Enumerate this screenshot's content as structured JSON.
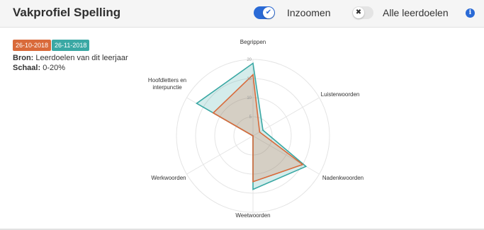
{
  "header": {
    "title": "Vakprofiel Spelling",
    "zoom_toggle": {
      "label": "Inzoomen",
      "state": "on",
      "icon": "check-icon"
    },
    "all_toggle": {
      "label": "Alle leerdoelen",
      "state": "off",
      "icon": "x-icon"
    },
    "info_icon": "info-icon"
  },
  "legend": {
    "badges": [
      {
        "label": "26-10-2018",
        "color": "#d96a3a"
      },
      {
        "label": "26-11-2018",
        "color": "#3aa8a4"
      }
    ]
  },
  "meta": {
    "source_label": "Bron:",
    "source_value": "Leerdoelen van dit leerjaar",
    "scale_label": "Schaal:",
    "scale_value": "0-20%"
  },
  "chart_data": {
    "type": "radar",
    "axes": [
      "Begrippen",
      "Luisterwoorden",
      "Nadenkwoorden",
      "Weetwoorden",
      "Werkwoorden",
      "Hoofdletters en interpunctie"
    ],
    "range": [
      0,
      20
    ],
    "ticks": [
      "5",
      "10",
      "15",
      "20"
    ],
    "series": [
      {
        "name": "26-10-2018",
        "color": "#d96a3a",
        "values": [
          16,
          2,
          15,
          12,
          0,
          12
        ]
      },
      {
        "name": "26-11-2018",
        "color": "#3aa8a4",
        "values": [
          19,
          3,
          16,
          14,
          0,
          17
        ]
      }
    ]
  }
}
